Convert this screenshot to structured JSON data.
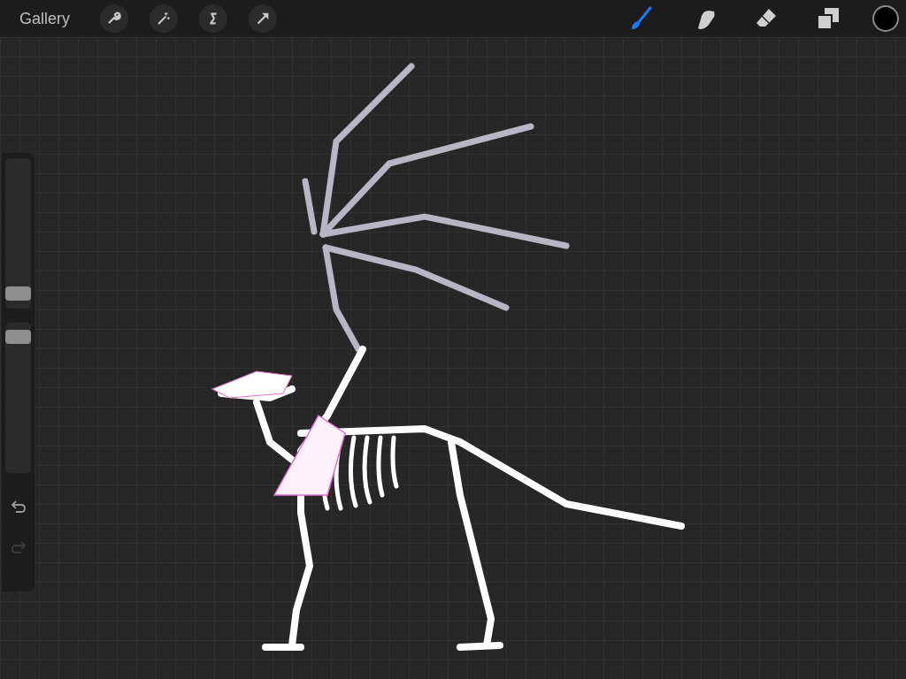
{
  "top_bar": {
    "gallery_label": "Gallery",
    "tools": [
      {
        "kind": "brush",
        "selected": true
      },
      {
        "kind": "smudge",
        "selected": false
      },
      {
        "kind": "eraser",
        "selected": false
      }
    ],
    "color": "#000000"
  },
  "sidebar": {
    "sliders": [
      {
        "level": 0.06
      },
      {
        "level": 0.95
      }
    ],
    "buttons": [
      {
        "kind": "undo",
        "disabled": false
      },
      {
        "kind": "redo",
        "disabled": true
      }
    ]
  }
}
